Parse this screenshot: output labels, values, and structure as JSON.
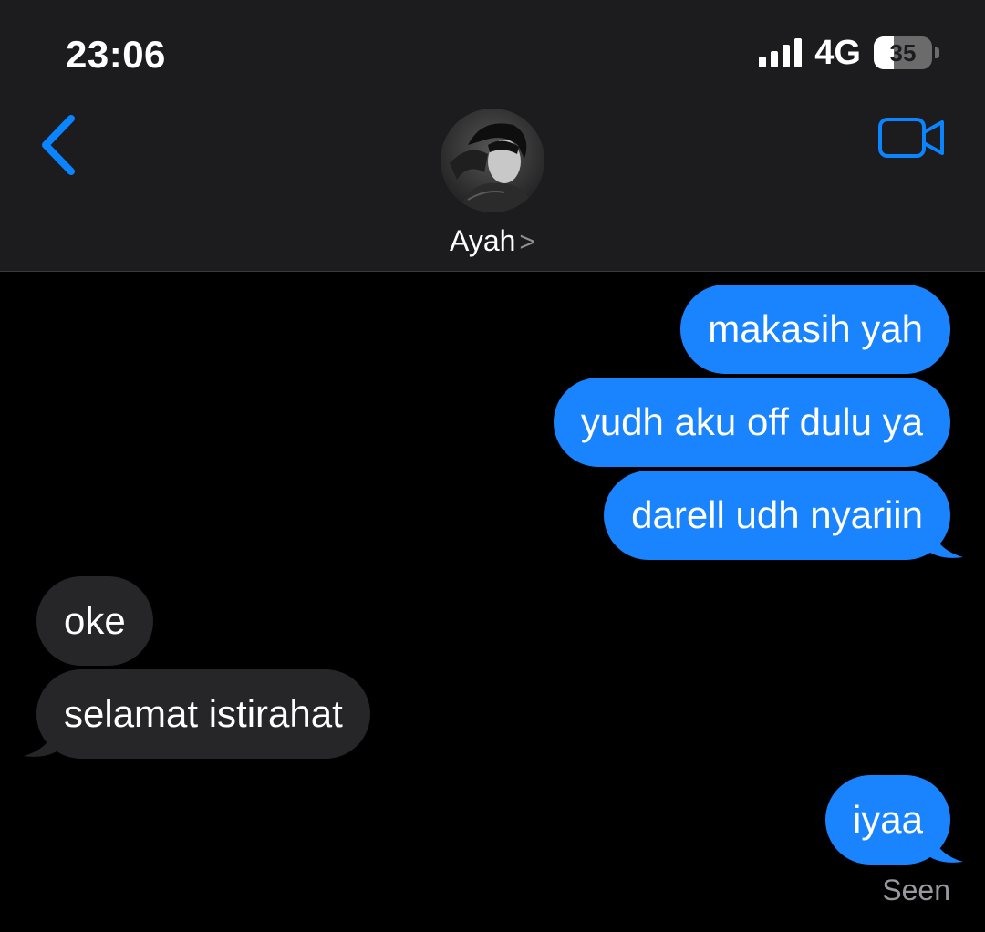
{
  "status_bar": {
    "time": "23:06",
    "network": "4G",
    "battery_percent": "35",
    "battery_level": 0.35
  },
  "nav": {
    "back_icon": "chevron-left-icon",
    "video_icon": "video-camera-icon",
    "contact_name": "Ayah",
    "contact_chevron": ">"
  },
  "messages": [
    {
      "direction": "sent",
      "text": "makasih yah"
    },
    {
      "direction": "sent",
      "text": "yudh aku off dulu ya"
    },
    {
      "direction": "sent",
      "text": "darell udh nyariin"
    },
    {
      "direction": "received",
      "text": "oke"
    },
    {
      "direction": "received",
      "text": "selamat istirahat"
    },
    {
      "direction": "sent",
      "text": "iyaa"
    }
  ],
  "read_receipt": "Seen",
  "colors": {
    "accent": "#0a84ff",
    "sent_bubble": "#1a84ff",
    "received_bubble": "#262628",
    "header_bg": "#1c1c1e",
    "background": "#000000"
  }
}
